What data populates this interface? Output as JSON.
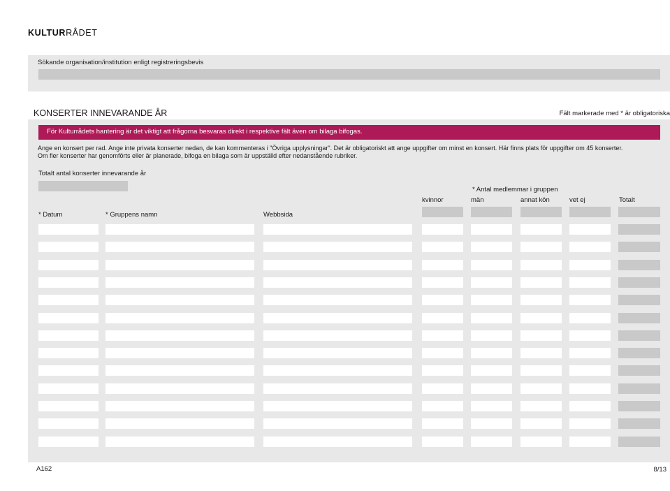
{
  "logo": {
    "bold": "KULTUR",
    "light": "RÅDET"
  },
  "org": {
    "label": "Sökande organisation/institution enligt registreringsbevis",
    "value": ""
  },
  "section": {
    "title": "KONSERTER INNEVARANDE ÅR",
    "required_note": "Fält markerade med * är obligatoriska"
  },
  "banner": {
    "text": "För Kulturrådets hantering är det viktigt att frågorna besvaras direkt i respektive fält även om bilaga bifogas."
  },
  "instructions": {
    "line1": "Ange en konsert per rad. Ange inte privata konserter nedan, de kan kommenteras i \"Övriga upplysningar\". Det är obligatoriskt att ange uppgifter om minst en konsert. Här finns plats för uppgifter om 45 konserter.",
    "line2": "Om fler konserter har genomförts eller är planerade, bifoga en bilaga som är uppställd efter nedanstående rubriker."
  },
  "total": {
    "label": "Totalt antal konserter innevarande år",
    "value": ""
  },
  "group_header": "* Antal medlemmar i gruppen",
  "columns": {
    "datum": "* Datum",
    "gruppnamn": "* Gruppens namn",
    "webbsida": "Webbsida",
    "kvinnor": "kvinnor",
    "man": "män",
    "annat_kon": "annat kön",
    "vet_ej": "vet ej",
    "totalt": "Totalt"
  },
  "rows": [
    {},
    {},
    {},
    {},
    {},
    {},
    {},
    {},
    {},
    {},
    {},
    {},
    {}
  ],
  "colors": {
    "accent": "#ad1a57",
    "panel": "#e8e8e8",
    "readonly_field": "#c9c9c9",
    "field": "#ffffff"
  },
  "footer": {
    "form_id": "A162",
    "page": "8/13"
  }
}
